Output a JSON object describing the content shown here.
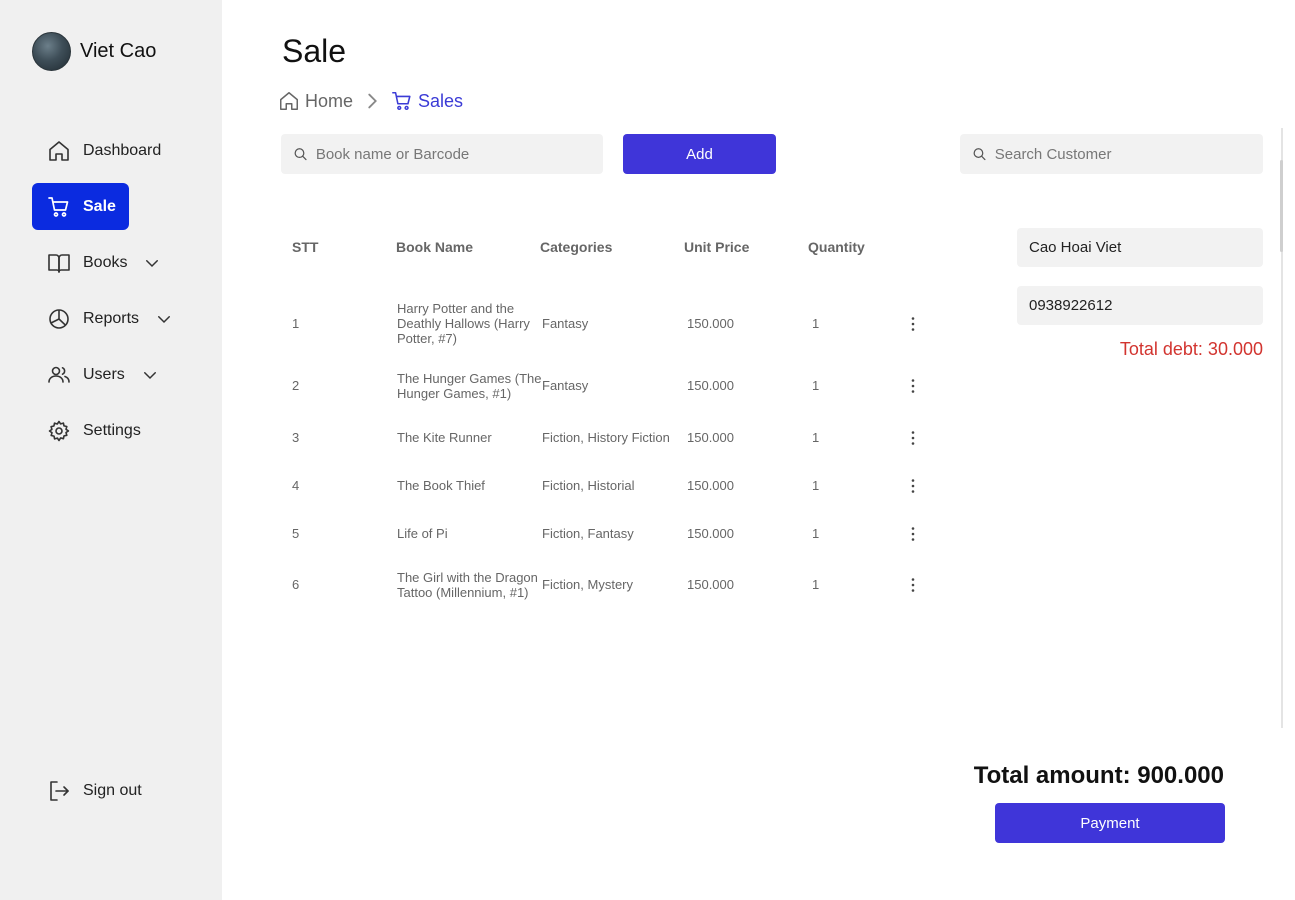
{
  "user": {
    "name": "Viet Cao"
  },
  "sidebar": {
    "items": [
      {
        "label": "Dashboard",
        "icon": "home-icon"
      },
      {
        "label": "Sale",
        "icon": "cart-icon",
        "active": true
      },
      {
        "label": "Books",
        "icon": "book-icon",
        "expandable": true
      },
      {
        "label": "Reports",
        "icon": "pie-chart-icon",
        "expandable": true
      },
      {
        "label": "Users",
        "icon": "users-icon",
        "expandable": true
      },
      {
        "label": "Settings",
        "icon": "gear-icon"
      }
    ],
    "signout": {
      "label": "Sign out",
      "icon": "sign-out-icon"
    }
  },
  "page": {
    "title": "Sale"
  },
  "breadcrumb": {
    "home": "Home",
    "current": "Sales"
  },
  "book_search": {
    "placeholder": "Book name or Barcode",
    "value": ""
  },
  "add_button": {
    "label": "Add"
  },
  "customer_search": {
    "placeholder": "Search Customer",
    "value": ""
  },
  "table": {
    "columns": [
      "STT",
      "Book Name",
      "Categories",
      "Unit Price",
      "Quantity"
    ],
    "rows": [
      {
        "stt": "1",
        "name": "Harry Potter and the Deathly Hallows (Harry Potter, #7)",
        "categories": "Fantasy",
        "price": "150.000",
        "qty": "1"
      },
      {
        "stt": "2",
        "name": "The Hunger Games (The Hunger Games, #1)",
        "categories": "Fantasy",
        "price": "150.000",
        "qty": "1"
      },
      {
        "stt": "3",
        "name": "The Kite Runner",
        "categories": "Fiction, History Fiction",
        "price": "150.000",
        "qty": "1"
      },
      {
        "stt": "4",
        "name": "The Book Thief",
        "categories": "Fiction, Historial",
        "price": "150.000",
        "qty": "1"
      },
      {
        "stt": "5",
        "name": "Life of Pi",
        "categories": "Fiction, Fantasy",
        "price": "150.000",
        "qty": "1"
      },
      {
        "stt": "6",
        "name": "The Girl with the Dragon Tattoo (Millennium, #1)",
        "categories": "Fiction, Mystery",
        "price": "150.000",
        "qty": "1"
      }
    ]
  },
  "customer": {
    "name": "Cao Hoai Viet",
    "phone": "0938922612",
    "debt_text": "Total debt: 30.000"
  },
  "summary": {
    "total_text": "Total amount: 900.000"
  },
  "payment_button": {
    "label": "Payment"
  },
  "colors": {
    "active": "#0b2be0",
    "accent": "#3f35d9",
    "debt": "#d2342f",
    "sidebar_bg": "#f0f0f0"
  }
}
